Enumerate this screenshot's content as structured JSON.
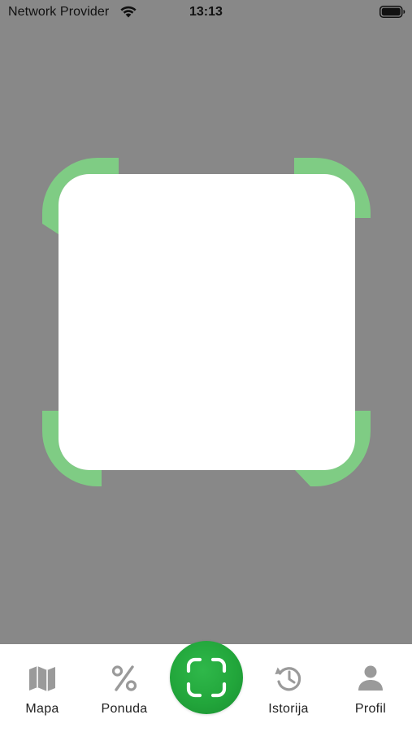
{
  "status_bar": {
    "carrier": "Network Provider",
    "time": "13:13",
    "wifi_icon": "wifi-icon",
    "battery_icon": "battery-full-icon"
  },
  "scanner": {
    "frame_color": "#7fcc84",
    "window_color": "#ffffff",
    "overlay_color": "#888888"
  },
  "tab_bar": {
    "active_color": "#22a63b",
    "items": [
      {
        "label": "Mapa",
        "icon": "map-icon"
      },
      {
        "label": "Ponuda",
        "icon": "percent-icon"
      },
      {
        "label": "",
        "icon": "scan-icon"
      },
      {
        "label": "Istorija",
        "icon": "history-icon"
      },
      {
        "label": "Profil",
        "icon": "person-icon"
      }
    ]
  }
}
